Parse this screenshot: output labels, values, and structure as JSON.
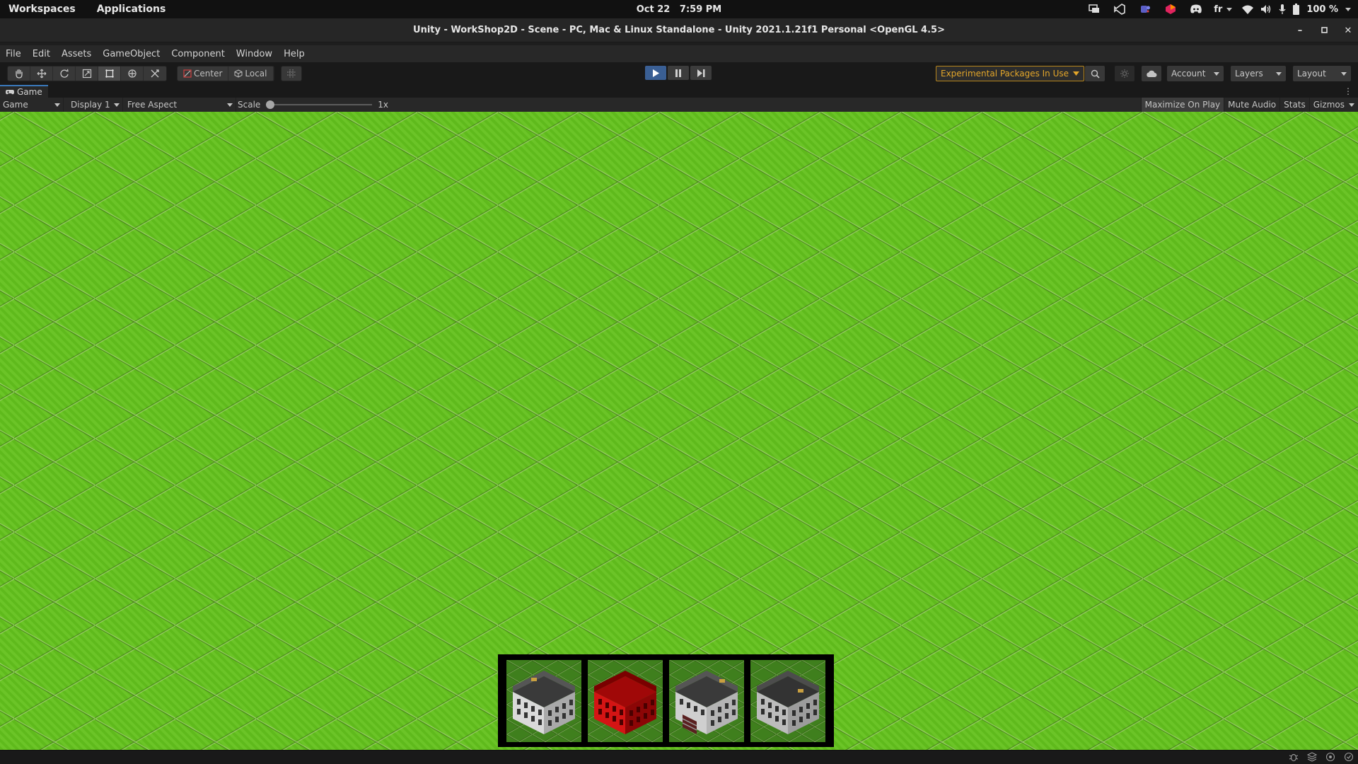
{
  "topbar": {
    "workspaces": "Workspaces",
    "applications": "Applications",
    "date": "Oct 22",
    "time": "7:59 PM",
    "keyboard_layout": "fr",
    "battery": "100 %"
  },
  "window": {
    "title": "Unity - WorkShop2D - Scene - PC, Mac & Linux Standalone - Unity 2021.1.21f1 Personal <OpenGL 4.5>"
  },
  "menu": {
    "items": [
      "File",
      "Edit",
      "Assets",
      "GameObject",
      "Component",
      "Window",
      "Help"
    ]
  },
  "toolbar": {
    "pivot_center": "Center",
    "pivot_local": "Local",
    "experimental_packages": "Experimental Packages In Use",
    "account": "Account",
    "layers": "Layers",
    "layout": "Layout"
  },
  "game_view": {
    "tab_label": "Game",
    "view_mode": "Game",
    "display": "Display 1",
    "aspect": "Free Aspect",
    "scale_label": "Scale",
    "scale_value": "1x",
    "maximize_on_play": "Maximize On Play",
    "mute_audio": "Mute Audio",
    "stats": "Stats",
    "gizmos": "Gizmos"
  },
  "buildings": [
    "white-apartment",
    "red-apartment",
    "white-apartment-stairs",
    "grey-apartment"
  ],
  "colors": {
    "grass": "#65c21e",
    "play_active": "#3a5f94",
    "experimental_warning": "#e3a62a",
    "building_red": "#c01010",
    "building_white": "#d6d6d6"
  }
}
